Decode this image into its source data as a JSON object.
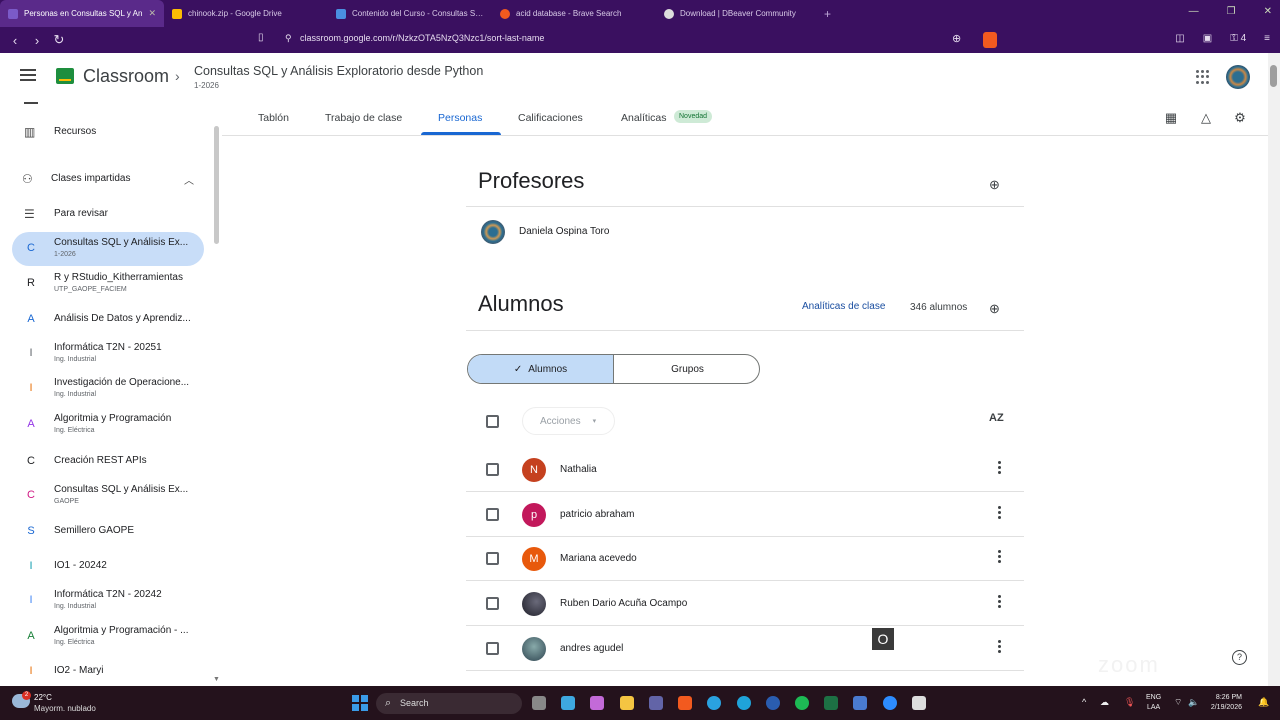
{
  "browser": {
    "tabs": [
      {
        "title": "Personas en Consultas SQL y An",
        "active": true,
        "color": "#7b5ac8"
      },
      {
        "title": "chinook.zip - Google Drive",
        "active": false,
        "color": "#fbbc04"
      },
      {
        "title": "Contenido del Curso - Consultas SQL",
        "active": false,
        "color": "#4a8fe0"
      },
      {
        "title": "acid database - Brave Search",
        "active": false,
        "color": "#f25a1f"
      },
      {
        "title": "Download | DBeaver Community",
        "active": false,
        "color": "#dddddd"
      }
    ],
    "url": "classroom.google.com/r/NzkzOTA5NzQ3Nzc1/sort-last-name",
    "ext_count": "4"
  },
  "header": {
    "app_name": "Classroom",
    "course_title": "Consultas SQL y Análisis Exploratorio desde Python",
    "course_sub": "1-2026"
  },
  "sidebar": {
    "recursos": "Recursos",
    "clases_impartidas": "Clases impartidas",
    "para_revisar": "Para revisar",
    "classes": [
      {
        "letter": "C",
        "name": "Consultas SQL y Análisis Ex...",
        "sub": "1-2026",
        "color": "#1967d2",
        "selected": true
      },
      {
        "letter": "R",
        "name": "R y RStudio_Kitherramientas",
        "sub": "UTP_GAOPE_FACIEM",
        "color": "#202124"
      },
      {
        "letter": "A",
        "name": "Análisis De Datos y Aprendiz...",
        "sub": "",
        "color": "#1967d2"
      },
      {
        "letter": "I",
        "name": "Informática T2N - 20251",
        "sub": "Ing. Industrial",
        "color": "#5f6368"
      },
      {
        "letter": "I",
        "name": "Investigación de Operacione...",
        "sub": "Ing. Industrial",
        "color": "#e8710a"
      },
      {
        "letter": "A",
        "name": "Algoritmia y Programación",
        "sub": "Ing. Eléctrica",
        "color": "#9334e6"
      },
      {
        "letter": "C",
        "name": "Creación REST APIs",
        "sub": "",
        "color": "#202124"
      },
      {
        "letter": "C",
        "name": "Consultas SQL y Análisis Ex...",
        "sub": "GAOPE",
        "color": "#d01884"
      },
      {
        "letter": "S",
        "name": "Semillero GAOPE",
        "sub": "",
        "color": "#1967d2"
      },
      {
        "letter": "I",
        "name": "IO1 - 20242",
        "sub": "",
        "color": "#129eaf"
      },
      {
        "letter": "I",
        "name": "Informática T2N - 20242",
        "sub": "Ing. Industrial",
        "color": "#4285f4"
      },
      {
        "letter": "A",
        "name": "Algoritmia y Programación - ...",
        "sub": "Ing. Eléctrica",
        "color": "#188038"
      },
      {
        "letter": "I",
        "name": "IO2 - Maryi",
        "sub": "",
        "color": "#e8710a"
      }
    ]
  },
  "tabs": {
    "tablon": "Tablón",
    "trabajo": "Trabajo de clase",
    "personas": "Personas",
    "calificaciones": "Calificaciones",
    "analiticas": "Analíticas",
    "novedad": "Novedad"
  },
  "people": {
    "profesores_title": "Profesores",
    "teacher_name": "Daniela Ospina Toro",
    "alumnos_title": "Alumnos",
    "analiticas_link": "Analíticas de clase",
    "count": "346 alumnos",
    "seg_alumnos": "Alumnos",
    "seg_grupos": "Grupos",
    "acciones": "Acciones",
    "sort_label": "AZ",
    "students": [
      {
        "initial": "N",
        "name": "Nathalia",
        "color": "#c5411f"
      },
      {
        "initial": "p",
        "name": "patricio abraham",
        "color": "#c2185b"
      },
      {
        "initial": "M",
        "name": "Mariana acevedo",
        "color": "#e8590c"
      },
      {
        "initial": "",
        "name": "Ruben Dario Acuña Ocampo",
        "color": "#2d2d3a"
      },
      {
        "initial": "",
        "name": "andres agudel",
        "color": "#3d5566"
      }
    ],
    "overlay_char": "O"
  },
  "taskbar": {
    "temp": "22°C",
    "condition": "Mayorm. nublado",
    "weather_badge": "2",
    "search": "Search",
    "lang1": "ENG",
    "lang2": "LAA",
    "time": "8:26 PM",
    "date": "2/19/2026"
  },
  "help_glyph": "?",
  "watermark": "zoom"
}
